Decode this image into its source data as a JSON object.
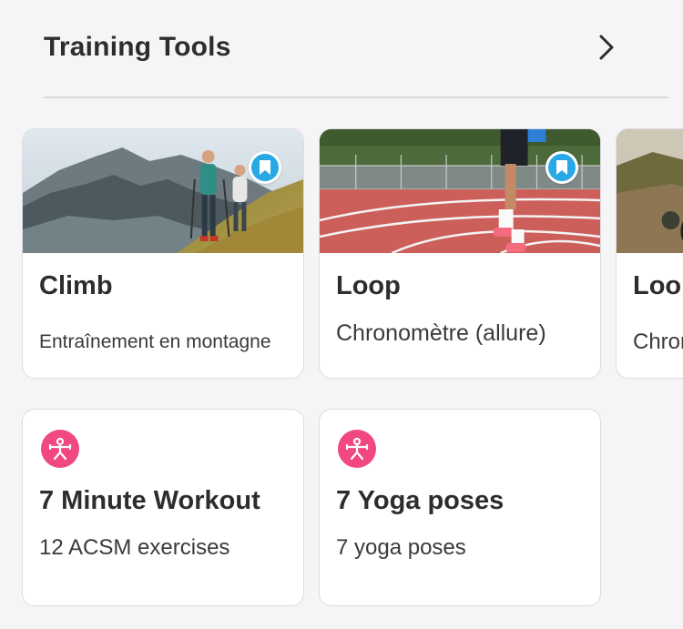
{
  "header": {
    "title": "Training Tools",
    "chevron_icon": "chevron-right-icon"
  },
  "featured_cards": [
    {
      "title": "Climb",
      "subtitle": "Entraînement en montagne",
      "image": "mountain-hikers-photo",
      "bookmark_icon": "bookmark-icon",
      "bookmarked": true
    },
    {
      "title": "Loop",
      "subtitle": "Chronomètre (allure)",
      "image": "running-track-photo",
      "bookmark_icon": "bookmark-icon",
      "bookmarked": true
    },
    {
      "title": "Loo",
      "subtitle": "Chron",
      "image": "trail-bike-photo"
    }
  ],
  "tool_cards": [
    {
      "title": "7 Minute Workout",
      "subtitle": "12 ACSM exercises",
      "icon": "workout-person-icon"
    },
    {
      "title": "7 Yoga poses",
      "subtitle": "7 yoga poses",
      "icon": "workout-person-icon"
    }
  ],
  "colors": {
    "background": "#f5f5f7",
    "card_border": "#dcdce0",
    "bookmark_blue": "#28a9e6",
    "tool_icon_pink": "#f0487f"
  }
}
